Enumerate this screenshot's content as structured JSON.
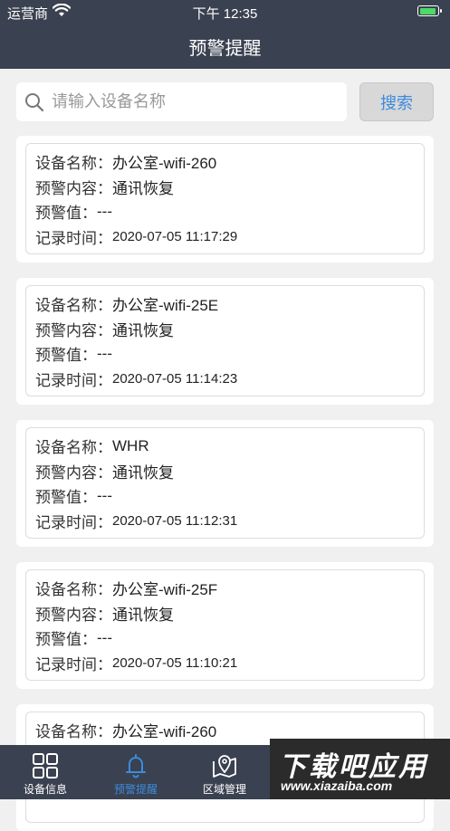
{
  "status_bar": {
    "carrier": "运营商",
    "time": "下午 12:35"
  },
  "nav": {
    "title": "预警提醒"
  },
  "search": {
    "placeholder": "请输入设备名称",
    "button_label": "搜索"
  },
  "labels": {
    "device_name": "设备名称：",
    "alert_content": "预警内容：",
    "alert_value": "预警值：",
    "record_time": "记录时间："
  },
  "alerts": [
    {
      "device": "办公室-wifi-260",
      "content": "通讯恢复",
      "value": "---",
      "time": "2020-07-05 11:17:29"
    },
    {
      "device": "办公室-wifi-25E",
      "content": "通讯恢复",
      "value": "---",
      "time": "2020-07-05 11:14:23"
    },
    {
      "device": "WHR",
      "content": "通讯恢复",
      "value": "---",
      "time": "2020-07-05 11:12:31"
    },
    {
      "device": "办公室-wifi-25F",
      "content": "通讯恢复",
      "value": "---",
      "time": "2020-07-05 11:10:21"
    },
    {
      "device": "办公室-wifi-260",
      "content": "",
      "value": "",
      "time": ""
    }
  ],
  "tabs": [
    {
      "label": "设备信息",
      "icon": "grid-icon",
      "active": false
    },
    {
      "label": "预警提醒",
      "icon": "bell-icon",
      "active": true
    },
    {
      "label": "区域管理",
      "icon": "map-pin-icon",
      "active": false
    }
  ],
  "watermark": {
    "main": "下载吧应用",
    "sub": "www.xiazaiba.com"
  },
  "colors": {
    "bar_bg": "#3a4150",
    "accent": "#3d8bdc",
    "battery": "#4cd964"
  }
}
